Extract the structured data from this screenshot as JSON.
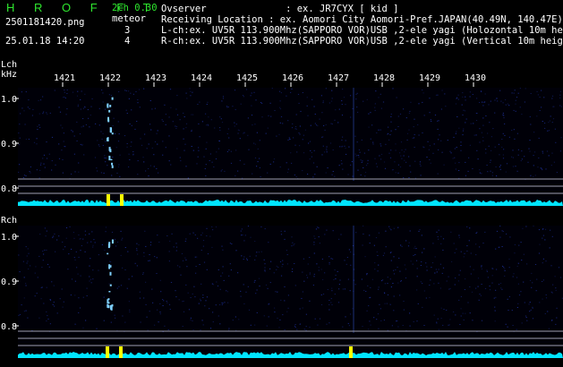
{
  "app": {
    "title": "H R O F F T",
    "version": "2ch 0.30",
    "filename": "2501181420.png",
    "datetime": "25.01.18 14:20",
    "meteor_label": "meteor",
    "meteor_lch": "3",
    "meteor_rch": "4"
  },
  "info": {
    "observer": "Ovserver              : ex. JR7CYX [ kid ]",
    "location": "Receiving Location : ex. Aomori City Aomori-Pref.JAPAN(40.49N, 140.47E)",
    "lch": "L-ch:ex. UV5R 113.900Mhz(SAPPORO VOR)USB ,2-ele yagi (Holozontal 10m height)",
    "rch": "R-ch:ex. UV5R 113.900Mhz(SAPPORO VOR)USB ,2-ele yagi (Vertical 10m height)"
  },
  "panels": {
    "lch_label": "Lch",
    "unit_label": "kHz",
    "rch_label": "Rch",
    "x_ticks": [
      "1421",
      "1422",
      "1423",
      "1424",
      "1425",
      "1426",
      "1427",
      "1428",
      "1429",
      "1430"
    ],
    "y_ticks": [
      "1.0",
      "0.9",
      "0.8"
    ]
  },
  "colors": {
    "background": "#000000",
    "waterfall_noise": "#1a2a8a",
    "meteor_trace": "#7fd0ff",
    "spectrum": "#00e5ff",
    "spectrum_peak": "#ffff00",
    "header_green": "#2ee62e"
  }
}
